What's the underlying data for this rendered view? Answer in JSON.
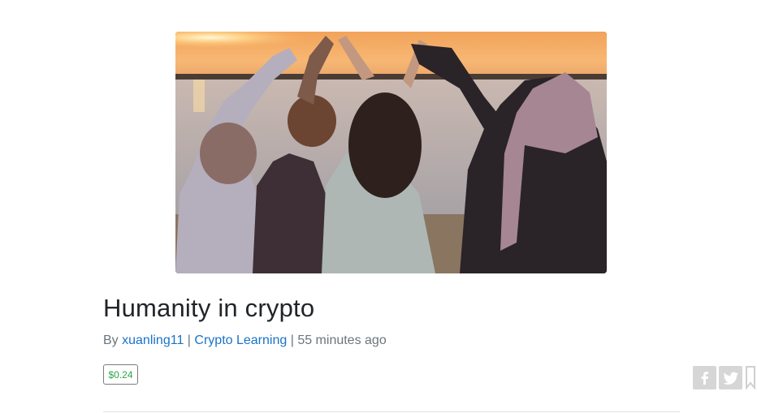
{
  "post": {
    "title": "Humanity in crypto",
    "by_label": "By",
    "author": "xuanling11",
    "separator": "|",
    "community": "Crypto Learning",
    "time_ago": "55 minutes ago",
    "payout": "$0.24"
  },
  "hero_image": {
    "alt": "",
    "description_icon": "photo"
  },
  "share": {
    "icons": [
      "facebook-icon",
      "twitter-icon",
      "bookmark-icon"
    ]
  },
  "colors": {
    "link": "#1a73c8",
    "payout": "#28a745",
    "title": "#212529",
    "meta": "#6c757d"
  }
}
